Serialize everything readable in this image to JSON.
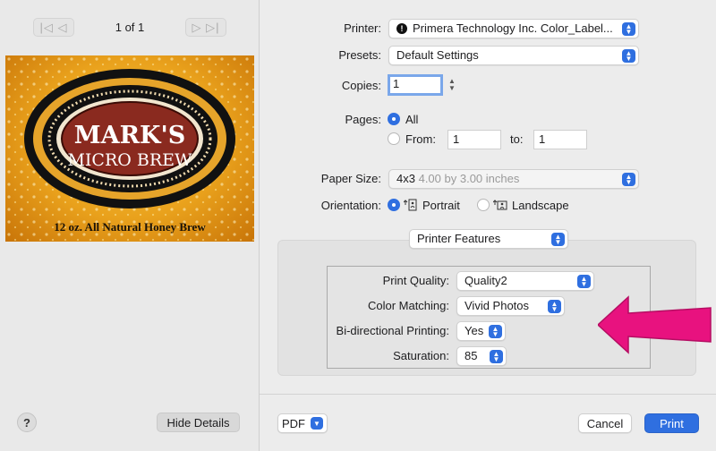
{
  "preview": {
    "prev_label": "|◁ ◁",
    "next_label": "▷ ▷|",
    "page_count": "1 of 1",
    "label_line1": "MARK'S",
    "label_line2": "MICRO BREW",
    "label_bottom": "12 oz. All Natural Honey Brew"
  },
  "footer_left": {
    "help_label": "?",
    "hide_details_label": "Hide Details"
  },
  "printer": {
    "label": "Printer:",
    "value": "Primera Technology Inc. Color_Label..."
  },
  "presets": {
    "label": "Presets:",
    "value": "Default Settings"
  },
  "copies": {
    "label": "Copies:",
    "value": "1"
  },
  "pages": {
    "label": "Pages:",
    "all_label": "All",
    "from_label": "From:",
    "from_value": "1",
    "to_label": "to:",
    "to_value": "1",
    "selected": "All"
  },
  "paper_size": {
    "label": "Paper Size:",
    "value": "4x3",
    "detail": "4.00 by 3.00 inches"
  },
  "orientation": {
    "label": "Orientation:",
    "portrait_label": "Portrait",
    "landscape_label": "Landscape",
    "selected": "Portrait"
  },
  "features_menu": {
    "value": "Printer Features"
  },
  "features": {
    "print_quality": {
      "label": "Print Quality:",
      "value": "Quality2"
    },
    "color_matching": {
      "label": "Color Matching:",
      "value": "Vivid Photos"
    },
    "bidirectional": {
      "label": "Bi-directional Printing:",
      "value": "Yes"
    },
    "saturation": {
      "label": "Saturation:",
      "value": "85"
    }
  },
  "footer_right": {
    "pdf_label": "PDF",
    "cancel_label": "Cancel",
    "print_label": "Print"
  },
  "colors": {
    "accent": "#2f6fe0",
    "arrow": "#e8127f"
  }
}
